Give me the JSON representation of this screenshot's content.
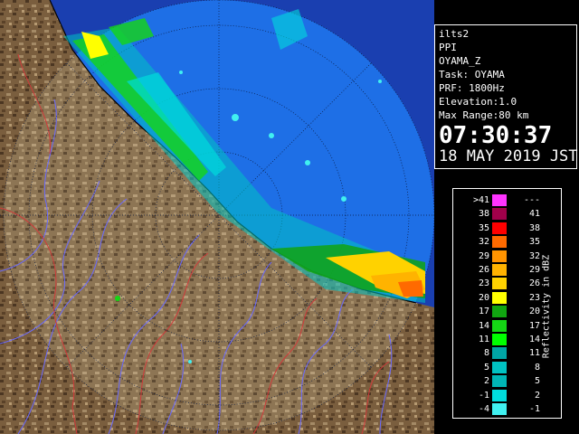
{
  "info": {
    "lines": [
      "ilts2",
      "PPI",
      "OYAMA_Z",
      "Task: OYAMA",
      "PRF: 1800Hz",
      "Elevation:1.0",
      "Max Range:80 km"
    ],
    "time": "07:30:37",
    "date": "18 MAY 2019 JST"
  },
  "legend": {
    "unit": "Reflectivity in dBZ",
    "rows": [
      {
        "left": ">41",
        "right": "---",
        "color": "#ff33ff"
      },
      {
        "left": "38",
        "right": "41",
        "color": "#a0004a"
      },
      {
        "left": "35",
        "right": "38",
        "color": "#ff0000"
      },
      {
        "left": "32",
        "right": "35",
        "color": "#ff6a00"
      },
      {
        "left": "29",
        "right": "32",
        "color": "#ff9400"
      },
      {
        "left": "26",
        "right": "29",
        "color": "#ffb300"
      },
      {
        "left": "23",
        "right": "26",
        "color": "#ffd200"
      },
      {
        "left": "20",
        "right": "23",
        "color": "#ffff00"
      },
      {
        "left": "17",
        "right": "20",
        "color": "#11a511"
      },
      {
        "left": "14",
        "right": "17",
        "color": "#15d615"
      },
      {
        "left": "11",
        "right": "14",
        "color": "#00ff00"
      },
      {
        "left": "8",
        "right": "11",
        "color": "#00a5a5"
      },
      {
        "left": "5",
        "right": "8",
        "color": "#00c2c2"
      },
      {
        "left": "2",
        "right": "5",
        "color": "#00b6b6"
      },
      {
        "left": "-1",
        "right": "2",
        "color": "#00dcdc"
      },
      {
        "left": "-4",
        "right": "-1",
        "color": "#40f0f0"
      }
    ]
  },
  "colors": {
    "coverage": "#1e6fe6",
    "sea": "#1a3fb0",
    "land": "#7a5e3e",
    "river_blue": "#6a6aff",
    "boundary_red": "#d03a3a"
  }
}
